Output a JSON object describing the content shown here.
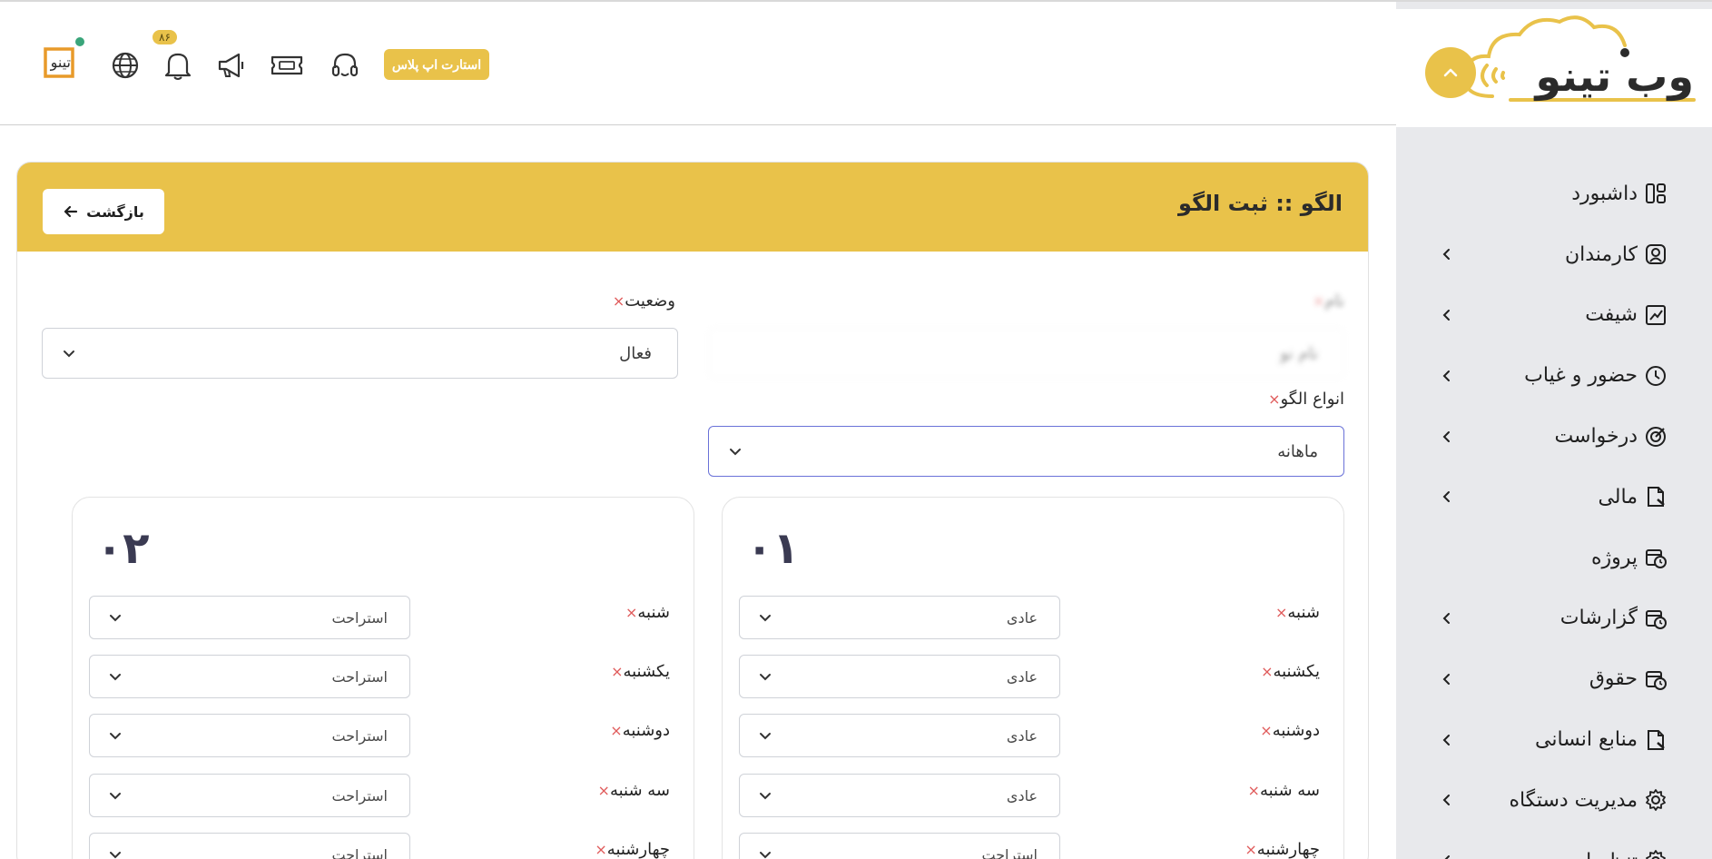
{
  "sidebar": {
    "logo_text": "وب تینو",
    "items": [
      {
        "label": "داشبورد",
        "icon": "layout-icon",
        "has_children": false
      },
      {
        "label": "کارمندان",
        "icon": "user-icon",
        "has_children": true
      },
      {
        "label": "شیفت",
        "icon": "chart-icon",
        "has_children": true
      },
      {
        "label": "حضور و غیاب",
        "icon": "clock-icon",
        "has_children": true
      },
      {
        "label": "درخواست",
        "icon": "target-icon",
        "has_children": true
      },
      {
        "label": "مالی",
        "icon": "file-icon",
        "has_children": true
      },
      {
        "label": "پروژه",
        "icon": "calendar-clock-icon",
        "has_children": false
      },
      {
        "label": "گزارشات",
        "icon": "calendar-clock-icon",
        "has_children": true
      },
      {
        "label": "حقوق",
        "icon": "calendar-clock-icon",
        "has_children": true
      },
      {
        "label": "منابع انسانی",
        "icon": "file-icon",
        "has_children": true
      },
      {
        "label": "مدیریت دستگاه",
        "icon": "gear-icon",
        "has_children": true
      },
      {
        "label": "تنظیمات",
        "icon": "gear-icon",
        "has_children": true
      }
    ]
  },
  "header": {
    "startup_badge": "استارت اپ پلاس",
    "notification_count": "۸۶",
    "brand_mini": "تینو"
  },
  "page": {
    "title": "الگو :: ثبت الگو",
    "back_label": "بازگشت"
  },
  "form": {
    "status_label": "وضعیت",
    "status_value": "فعال",
    "name_label": "نام",
    "name_value": "نام نو",
    "pattern_type_label": "انواع الگو",
    "pattern_type_value": "ماهانه"
  },
  "weeks": [
    {
      "number": "۰۱",
      "days": [
        {
          "label": "شنبه",
          "value": "عادی"
        },
        {
          "label": "یکشنبه",
          "value": "عادی"
        },
        {
          "label": "دوشنبه",
          "value": "عادی"
        },
        {
          "label": "سه شنبه",
          "value": "عادی"
        },
        {
          "label": "چهارشنبه",
          "value": "استراحت"
        }
      ]
    },
    {
      "number": "۰۲",
      "days": [
        {
          "label": "شنبه",
          "value": "استراحت"
        },
        {
          "label": "یکشنبه",
          "value": "استراحت"
        },
        {
          "label": "دوشنبه",
          "value": "استراحت"
        },
        {
          "label": "سه شنبه",
          "value": "استراحت"
        },
        {
          "label": "چهارشنبه",
          "value": "استراحت"
        }
      ]
    }
  ],
  "colors": {
    "accent": "#e9c24a",
    "required": "#e05b5b",
    "focus_border": "#6a72d8"
  }
}
